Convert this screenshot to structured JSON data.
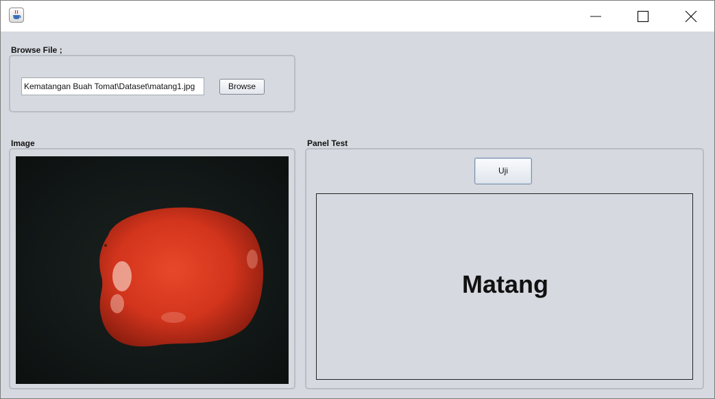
{
  "window": {
    "title": "",
    "icon": "java-cup-icon",
    "controls": [
      "minimize-icon",
      "maximize-icon",
      "close-icon"
    ]
  },
  "browse_section": {
    "label": "Browse File ;",
    "path_value": "Kematangan Buah Tomat\\Dataset\\matang1.jpg",
    "browse_button": "Browse"
  },
  "image_section": {
    "label": "Image",
    "image": "tomato-photo"
  },
  "test_section": {
    "label": "Panel Test",
    "test_button": "Uji",
    "result": "Matang"
  },
  "colors": {
    "window_bg": "#d6d9df",
    "titlebar_bg": "#ffffff",
    "image_bg": "#0f1514",
    "tomato": "#d8381e"
  }
}
